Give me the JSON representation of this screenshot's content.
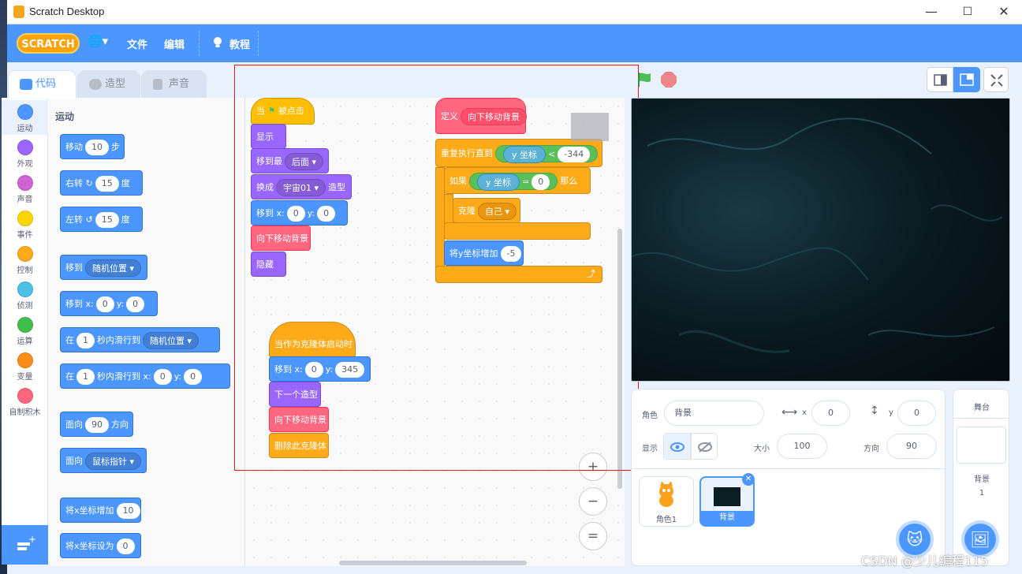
{
  "window": {
    "title": "Scratch Desktop",
    "min": "—",
    "max": "☐",
    "close": "✕"
  },
  "menu": {
    "logo": "SCRATCH",
    "globe": "🌐▾",
    "file": "文件",
    "edit": "编辑",
    "tutorials": "教程"
  },
  "tabs": {
    "code": "代码",
    "costumes": "造型",
    "sounds": "声音"
  },
  "categories": [
    {
      "label": "运动",
      "color": "#4c97ff"
    },
    {
      "label": "外观",
      "color": "#9966ff"
    },
    {
      "label": "声音",
      "color": "#cf63cf"
    },
    {
      "label": "事件",
      "color": "#ffd500"
    },
    {
      "label": "控制",
      "color": "#ffab19"
    },
    {
      "label": "侦测",
      "color": "#4cbfe6"
    },
    {
      "label": "运算",
      "color": "#40bf4a"
    },
    {
      "label": "变量",
      "color": "#ff8c1a"
    },
    {
      "label": "自制积木",
      "color": "#ff6680"
    }
  ],
  "palette": {
    "heading": "运动",
    "move": {
      "a": "移动",
      "v": "10",
      "b": "步"
    },
    "turn_right": {
      "a": "右转",
      "icon": "↻",
      "v": "15",
      "b": "度"
    },
    "turn_left": {
      "a": "左转",
      "icon": "↺",
      "v": "15",
      "b": "度"
    },
    "goto": {
      "a": "移到",
      "dd": "随机位置 ▾"
    },
    "goto_xy": {
      "a": "移到 x:",
      "x": "0",
      "y_label": "y:",
      "y": "0"
    },
    "glide": {
      "a": "在",
      "v": "1",
      "b": "秒内滑行到",
      "dd": "随机位置 ▾"
    },
    "glide_xy": {
      "a": "在",
      "v": "1",
      "b": "秒内滑行到 x:",
      "x": "0",
      "y_label": "y:",
      "y": "0"
    },
    "point": {
      "a": "面向",
      "v": "90",
      "b": "方向"
    },
    "point_towards": {
      "a": "面向",
      "dd": "鼠标指针 ▾"
    },
    "change_x": {
      "a": "将x坐标增加",
      "v": "10"
    },
    "set_x": {
      "a": "将x坐标设为",
      "v": "0"
    }
  },
  "script1": {
    "when_flag": {
      "a": "当",
      "b": "被点击"
    },
    "show": "显示",
    "goto_layer": {
      "a": "移到最",
      "dd": "后面 ▾"
    },
    "switch_costume": {
      "a": "换成",
      "dd": "宇宙01 ▾",
      "b": "造型"
    },
    "goto_xy": {
      "a": "移到 x:",
      "x": "0",
      "y_label": "y:",
      "y": "0"
    },
    "call": "向下移动背景",
    "hide": "隐藏"
  },
  "script2": {
    "define": "定义",
    "define_name": "向下移动背景",
    "repeat_until": "重复执行直到",
    "ycoord": "y 坐标",
    "lt": "<",
    "lt_val": "-344",
    "if": "如果",
    "eq": "=",
    "eq_val": "0",
    "then": "那么",
    "clone": "克隆",
    "clone_dd": "自己 ▾",
    "change_y": "将y坐标增加",
    "change_y_val": "-5",
    "loop_arrow": "⤴"
  },
  "script3": {
    "clone_hat": "当作为克隆体启动时",
    "goto_xy": {
      "a": "移到 x:",
      "x": "0",
      "y_label": "y:",
      "y": "345"
    },
    "next_costume": "下一个造型",
    "call": "向下移动背景",
    "delete_clone": "删除此克隆体"
  },
  "zoom": {
    "in": "+",
    "out": "−",
    "reset": "="
  },
  "sprite_info": {
    "sprite_label": "角色",
    "sprite_name": "背景",
    "x_label": "x",
    "x": "0",
    "y_label": "y",
    "y": "0",
    "show_label": "显示",
    "size_label": "大小",
    "size": "100",
    "dir_label": "方向",
    "dir": "90"
  },
  "sprites": [
    {
      "name": "角色1"
    },
    {
      "name": "背景"
    }
  ],
  "stage_panel": {
    "title": "舞台",
    "backdrops_label": "背景",
    "backdrops_count": "1"
  },
  "watermark": "CSDN @少儿编程115"
}
